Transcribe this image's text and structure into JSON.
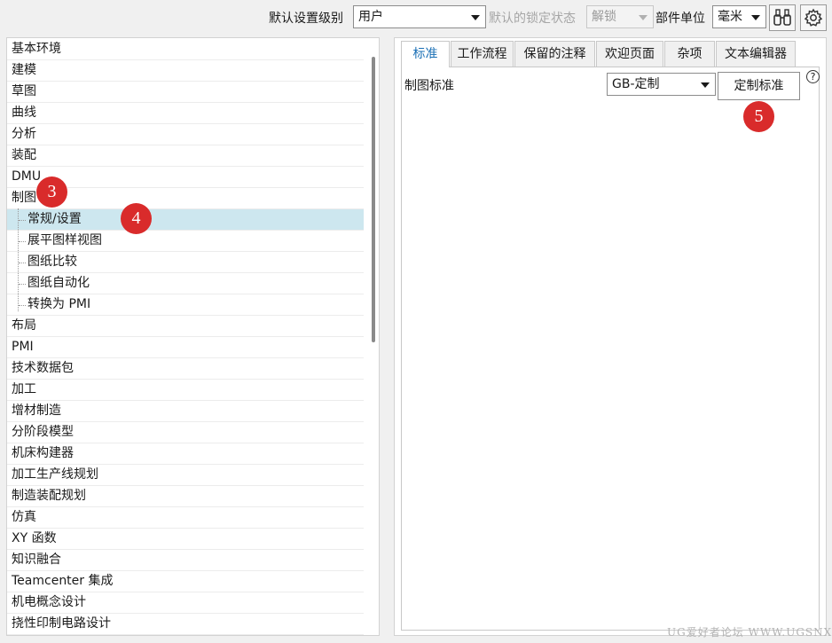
{
  "toolbar": {
    "level_label": "默认设置级别",
    "level_value": "用户",
    "lock_label": "默认的锁定状态",
    "lock_value": "解锁",
    "unit_label": "部件单位",
    "unit_value": "毫米",
    "find_icon": "binoculars-icon",
    "settings_icon": "gear-icon"
  },
  "tree": {
    "items": [
      {
        "label": "基本环境"
      },
      {
        "label": "建模"
      },
      {
        "label": "草图"
      },
      {
        "label": "曲线"
      },
      {
        "label": "分析"
      },
      {
        "label": "装配"
      },
      {
        "label": "DMU"
      },
      {
        "label": "制图"
      },
      {
        "label": "常规/设置"
      },
      {
        "label": "展平图样视图"
      },
      {
        "label": "图纸比较"
      },
      {
        "label": "图纸自动化"
      },
      {
        "label": "转换为 PMI"
      },
      {
        "label": "布局"
      },
      {
        "label": "PMI"
      },
      {
        "label": "技术数据包"
      },
      {
        "label": "加工"
      },
      {
        "label": "增材制造"
      },
      {
        "label": "分阶段模型"
      },
      {
        "label": "机床构建器"
      },
      {
        "label": "加工生产线规划"
      },
      {
        "label": "制造装配规划"
      },
      {
        "label": "仿真"
      },
      {
        "label": "XY 函数"
      },
      {
        "label": "知识融合"
      },
      {
        "label": "Teamcenter 集成"
      },
      {
        "label": "机电概念设计"
      },
      {
        "label": "挠性印制电路设计"
      }
    ],
    "selected_label": "常规/设置"
  },
  "tabs": [
    {
      "label": "标准"
    },
    {
      "label": "工作流程"
    },
    {
      "label": "保留的注释"
    },
    {
      "label": "欢迎页面"
    },
    {
      "label": "杂项"
    },
    {
      "label": "文本编辑器"
    }
  ],
  "standard_tab": {
    "field_label": "制图标准",
    "standard_value": "GB-定制",
    "customize_button": "定制标准",
    "help_glyph": "?"
  },
  "markers": [
    "3",
    "4",
    "5"
  ],
  "watermark": "UG爱好者论坛 WWW.UGSNX.COM",
  "colors": {
    "selected_row": "#cde7ef",
    "active_tab_text": "#1a6fb5",
    "marker": "#d92b2b"
  }
}
